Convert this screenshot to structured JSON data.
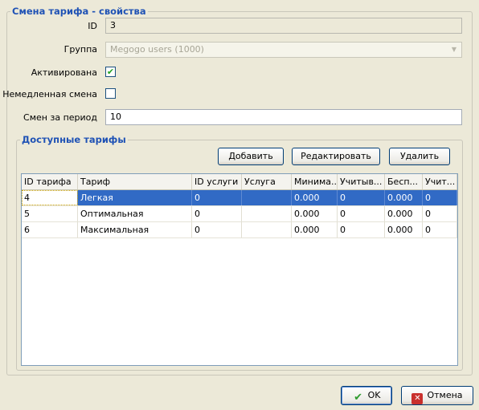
{
  "properties": {
    "title": "Смена тарифа - свойства",
    "id_label": "ID",
    "id_value": "3",
    "group_label": "Группа",
    "group_value": "Megogo users (1000)",
    "active_label": "Активирована",
    "active_checked": true,
    "immediate_label": "Немедленная смена",
    "immediate_checked": false,
    "changes_label": "Смен за период",
    "changes_value": "10"
  },
  "tariffs": {
    "title": "Доступные тарифы",
    "add_label": "Добавить",
    "edit_label": "Редактировать",
    "delete_label": "Удалить",
    "columns": [
      "ID тарифа",
      "Тариф",
      "ID услуги",
      "Услуга",
      "Минима...",
      "Учитыв...",
      "Бесп...",
      "Учит..."
    ],
    "rows": [
      [
        "4",
        "Легкая",
        "0",
        "",
        "0.000",
        "0",
        "0.000",
        "0"
      ],
      [
        "5",
        "Оптимальная",
        "0",
        "",
        "0.000",
        "0",
        "0.000",
        "0"
      ],
      [
        "6",
        "Максимальная",
        "0",
        "",
        "0.000",
        "0",
        "0.000",
        "0"
      ]
    ],
    "selected_row": 0
  },
  "footer": {
    "ok_label": "OK",
    "cancel_label": "Отмена"
  },
  "colors": {
    "accent": "#1f52b5",
    "selection": "#316ac5",
    "ok_icon": "#2e9c2e",
    "cancel_icon": "#c9302c"
  }
}
